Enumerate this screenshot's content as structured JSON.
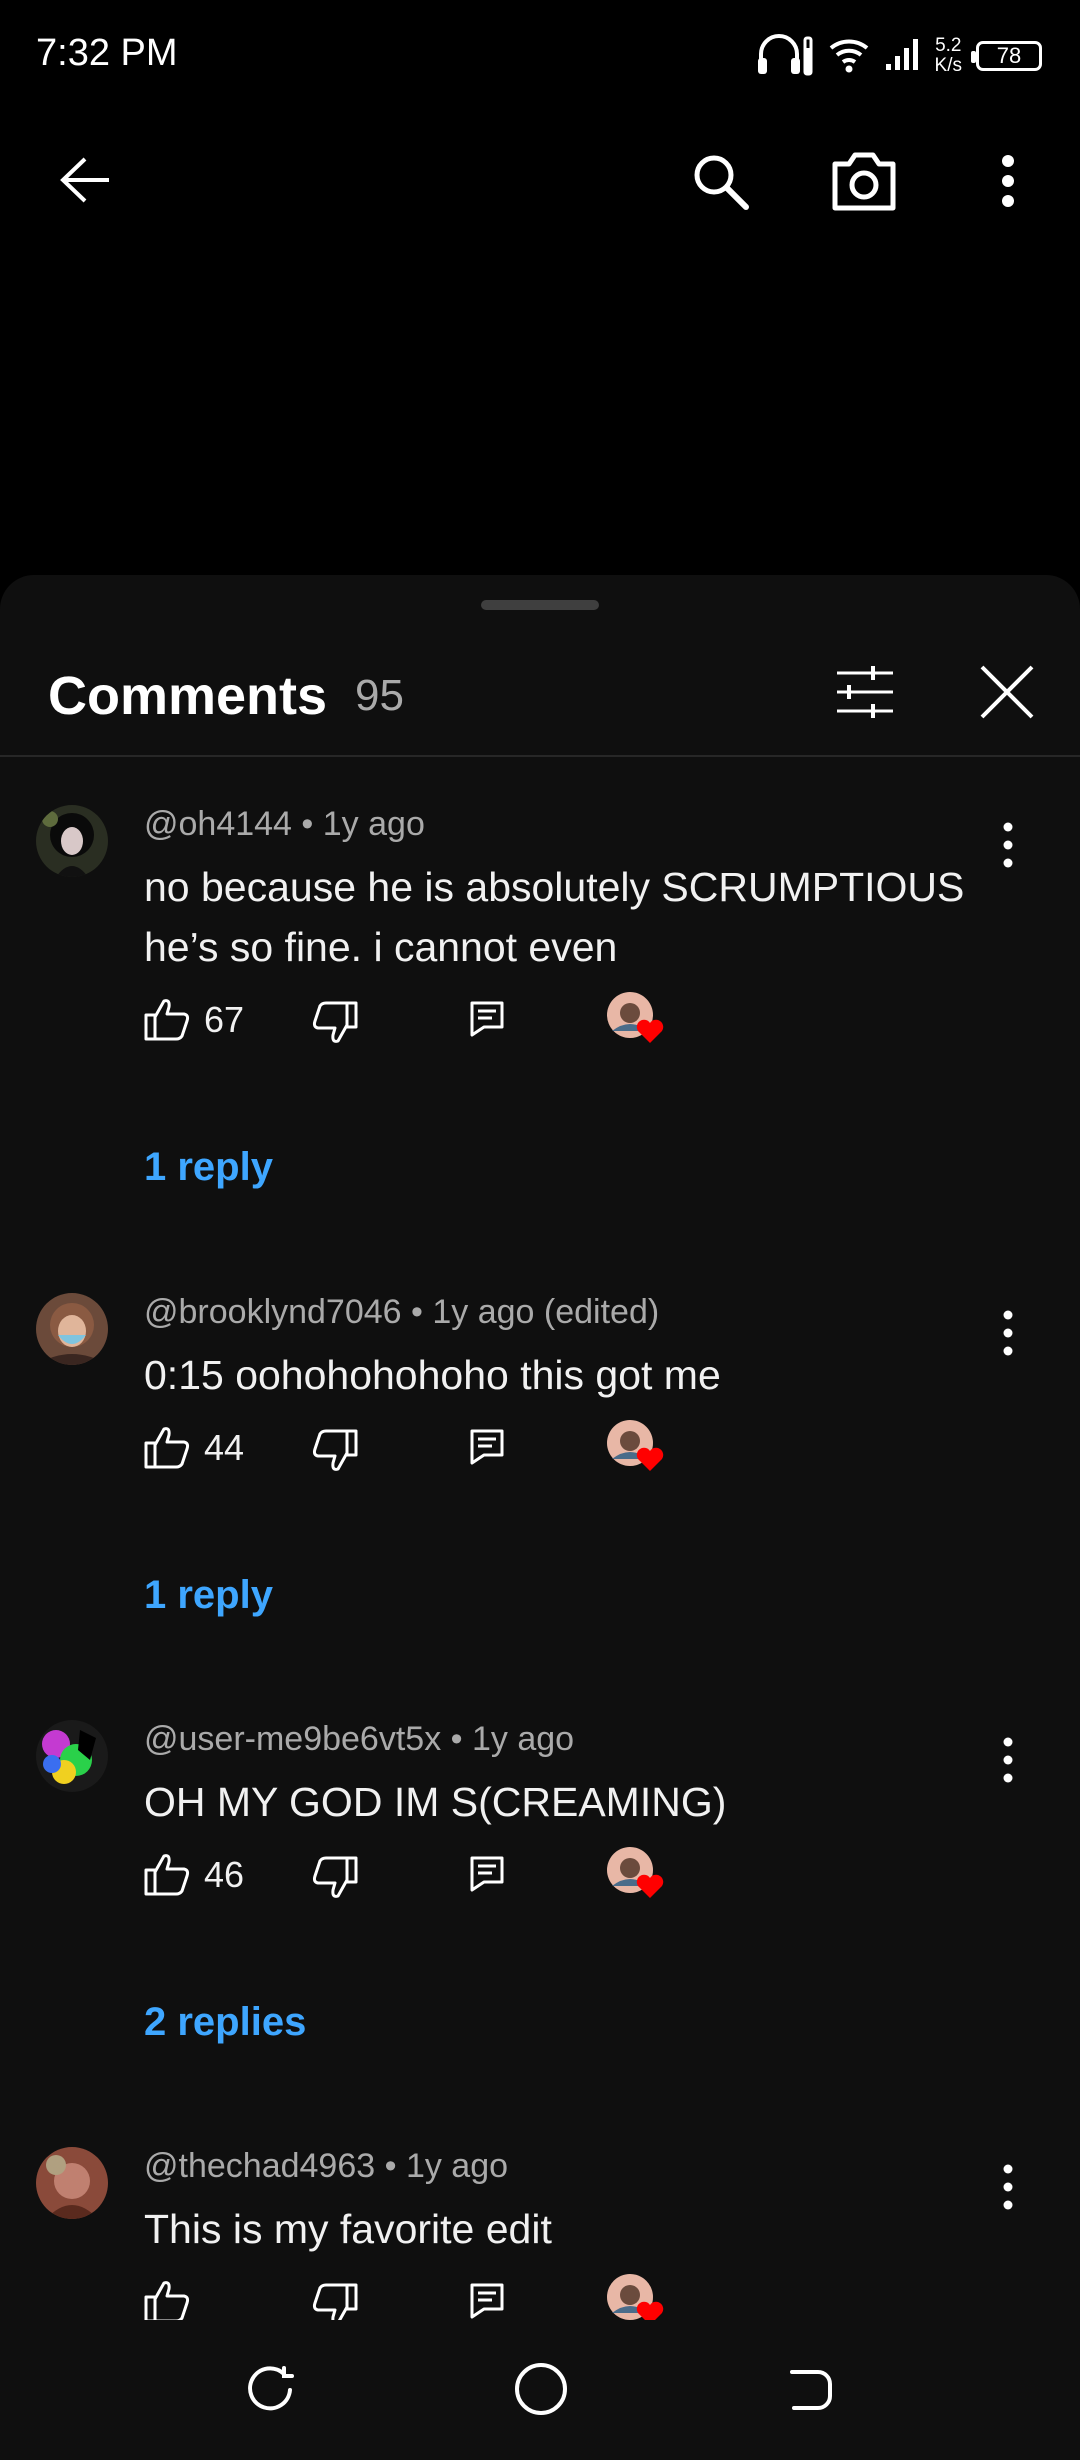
{
  "status_bar": {
    "time": "7:32 PM",
    "speed_value": "5.2",
    "speed_unit": "K/s",
    "battery": "78"
  },
  "top_bar": {
    "icons": [
      "back-arrow-icon",
      "search-icon",
      "camera-icon",
      "more-vert-icon"
    ]
  },
  "comments_sheet": {
    "title": "Comments",
    "count": "95",
    "comments": [
      {
        "author": "@oh4144",
        "age": "1y ago",
        "meta": "@oh4144 • 1y ago",
        "text_lines": [
          "no because he is absolutely SCRUMPTIOUS",
          "he’s so fine. i cannot even"
        ],
        "likes": "67",
        "replies": "1 reply",
        "creator_hearted": true
      },
      {
        "author": "@brooklynd7046",
        "age": "1y ago (edited)",
        "meta": "@brooklynd7046 • 1y ago (edited)",
        "text_lines": [
          "0:15 oohohohohoho this got me"
        ],
        "likes": "44",
        "replies": "1 reply",
        "creator_hearted": true
      },
      {
        "author": "@user-me9be6vt5x",
        "age": "1y ago",
        "meta": "@user-me9be6vt5x • 1y ago",
        "text_lines": [
          "OH MY GOD IM S(CREAMING)"
        ],
        "likes": "46",
        "replies": "2 replies",
        "creator_hearted": true
      },
      {
        "author": "@thechad4963",
        "age": "1y ago",
        "meta": "@thechad4963 • 1y ago",
        "text_lines": [
          "This is my favorite edit"
        ],
        "likes": "",
        "replies": "",
        "creator_hearted": true
      }
    ]
  },
  "colors": {
    "background": "#000000",
    "sheet": "#0f0f0f",
    "link": "#3ea6ff",
    "secondary_text": "#aaaaaa",
    "heart": "#ff0000"
  }
}
